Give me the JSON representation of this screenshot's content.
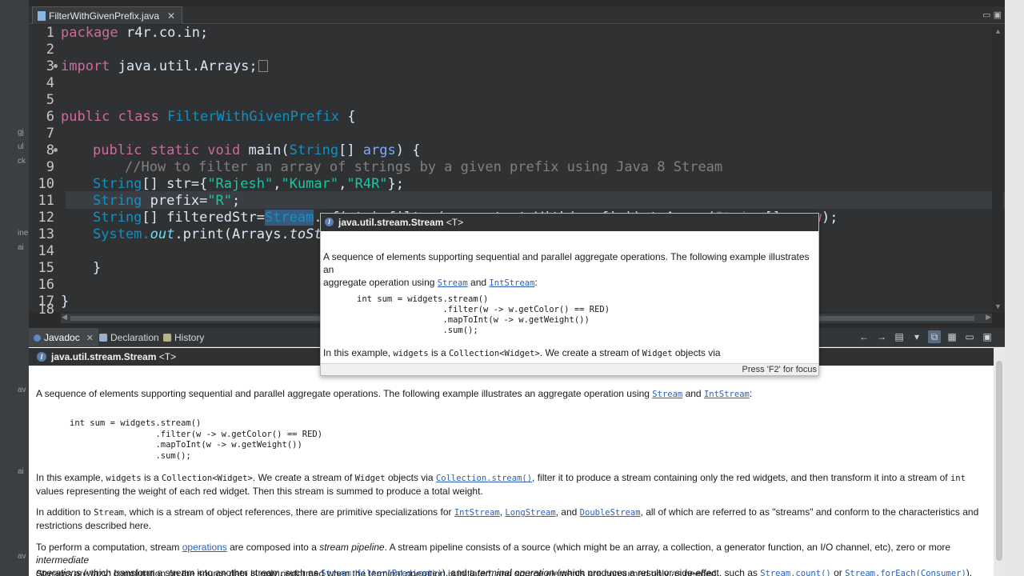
{
  "editor": {
    "tab_label": "FilterWithGivenPrefix.java",
    "tab_close": "✕",
    "minmax": "▭ ▣",
    "lines": [
      {
        "n": "1"
      },
      {
        "n": "2"
      },
      {
        "n": "3"
      },
      {
        "n": "4"
      },
      {
        "n": "5"
      },
      {
        "n": "6"
      },
      {
        "n": "7"
      },
      {
        "n": "8"
      },
      {
        "n": "9"
      },
      {
        "n": "10"
      },
      {
        "n": "11"
      },
      {
        "n": "12"
      },
      {
        "n": "13"
      },
      {
        "n": "14"
      },
      {
        "n": "15"
      },
      {
        "n": "16"
      },
      {
        "n": "17"
      },
      {
        "n": "18"
      }
    ],
    "code": {
      "l1_kw": "package",
      "l1_rest": " r4r.co.in;",
      "l3_kw": "import",
      "l3_rest": " java.util.Arrays;",
      "l6_kw": "public class",
      "l6_cls": " FilterWithGivenPrefix",
      "l6_rest": " {",
      "l8_kw": "public static void",
      "l8_m": " main(",
      "l8_cls": "String",
      "l8_rest": "[] ",
      "l8_param": "args",
      "l8_end": ") {",
      "l9_cmt": "//How to filter an array of strings by a given prefix using Java 8 Stream",
      "l10_cls": "String",
      "l10_a": "[] str={",
      "l10_s1": "\"Rajesh\"",
      "l10_c1": ",",
      "l10_s2": "\"Kumar\"",
      "l10_c2": ",",
      "l10_s3": "\"R4R\"",
      "l10_end": "};",
      "l11_cls": "String",
      "l11_a": " prefix=",
      "l11_s": "\"R\"",
      "l11_end": ";",
      "l12_cls": "String",
      "l12_a": "[] filteredStr=",
      "l12_stream": "Stream",
      "l12_dot": ".",
      "l12_of": "of",
      "l12_b": "(str).filter(s->s.startsWith(prefix)).toArray(",
      "l12_cls2": "String",
      "l12_c": "[]::",
      "l12_new": "new",
      "l12_end": ");",
      "l13_a": "System.",
      "l13_out": "out",
      "l13_b": ".print(Arrays.",
      "l13_to": "toSt",
      "l15": "}",
      "l17": "}"
    }
  },
  "panel": {
    "tabs": [
      {
        "label": "Javadoc",
        "close": "✕"
      },
      {
        "label": "Declaration"
      },
      {
        "label": "History"
      }
    ],
    "tools": [
      "←",
      "→",
      "▤",
      "▾",
      "⧉",
      "▦",
      "▭",
      "▣"
    ]
  },
  "javadoc": {
    "title": "java.util.stream.Stream",
    "type_param": " <T>",
    "p1_a": "A sequence of elements supporting sequential and parallel aggregate operations. The following example illustrates an aggregate operation using ",
    "p1_link1": "Stream",
    "p1_and": " and ",
    "p1_link2": "IntStream",
    "p1_end": ":",
    "pre": "int sum = widgets.stream()\n                 .filter(w -> w.getColor() == RED)\n                 .mapToInt(w -> w.getWeight())\n                 .sum();",
    "p2_a": "In this example, ",
    "p2_c1": "widgets",
    "p2_b": " is a ",
    "p2_c2": "Collection<Widget>",
    "p2_c": ". We create a stream of ",
    "p2_c3": "Widget",
    "p2_d": " objects via ",
    "p2_link": "Collection.stream()",
    "p2_e": ", filter it to produce a stream containing only the red widgets, and then transform it into a stream of ",
    "p2_c4": "int",
    "p2_f": "values representing the weight of each red widget. Then this stream is summed to produce a total weight.",
    "p3_a": "In addition to ",
    "p3_c1": "Stream",
    "p3_b": ", which is a stream of object references, there are primitive specializations for ",
    "p3_l1": "IntStream",
    "p3_comma": ", ",
    "p3_l2": "LongStream",
    "p3_and": ", and ",
    "p3_l3": "DoubleStream",
    "p3_c": ", all of which are referred to as \"streams\" and conform to the characteristics and",
    "p3_d": "restrictions described here.",
    "p4_a": "To perform a computation, stream ",
    "p4_l1": "operations",
    "p4_b": " are composed into a ",
    "p4_i1": "stream pipeline",
    "p4_c": ". A stream pipeline consists of a source (which might be an array, a collection, a generator function, an I/O channel, etc), zero or more ",
    "p4_i2": "intermediate",
    "p4_d_i": "operations",
    "p4_d": " (which transform a stream into another stream, such as ",
    "p4_l2": "Stream.filter(Predicate)",
    "p4_e": "), and a ",
    "p4_i3": "terminal operation",
    "p4_f": " (which produces a result or side-effect, such as ",
    "p4_l3": "Stream.count()",
    "p4_or": " or ",
    "p4_l4": "Stream.forEach(Consumer)",
    "p4_end": ").",
    "p5": "Streams are lazy; computation on the source data is only performed when the terminal operation is initiated, and source elements are consumed only as needed."
  },
  "popup": {
    "title": "java.util.stream.Stream",
    "type_param": " <T>",
    "p1": "A sequence of elements supporting sequential and parallel aggregate operations. The following example illustrates an",
    "p1b_a": "aggregate operation using ",
    "p1b_l1": "Stream",
    "p1b_and": " and ",
    "p1b_l2": "IntStream",
    "p1b_end": ":",
    "pre": "int sum = widgets.stream()\n                 .filter(w -> w.getColor() == RED)\n                 .mapToInt(w -> w.getWeight())\n                 .sum();",
    "p2_a": "In this example, ",
    "p2_c1": "widgets",
    "p2_b": " is a ",
    "p2_c2": "Collection<Widget>",
    "p2_c": ". We create a stream of ",
    "p2_c3": "Widget",
    "p2_d": " objects via",
    "hint": "Press 'F2' for focus"
  },
  "left_strip": [
    "gj",
    "ul",
    "ck",
    "ine",
    "ai",
    "av",
    "ai",
    "av"
  ],
  "colors": {
    "editor_bg": "#2f3133",
    "keyword": "#cc6c9d",
    "class": "#1290c3",
    "string": "#17c6a3",
    "comment": "#808080",
    "link": "#2a5fbd"
  }
}
